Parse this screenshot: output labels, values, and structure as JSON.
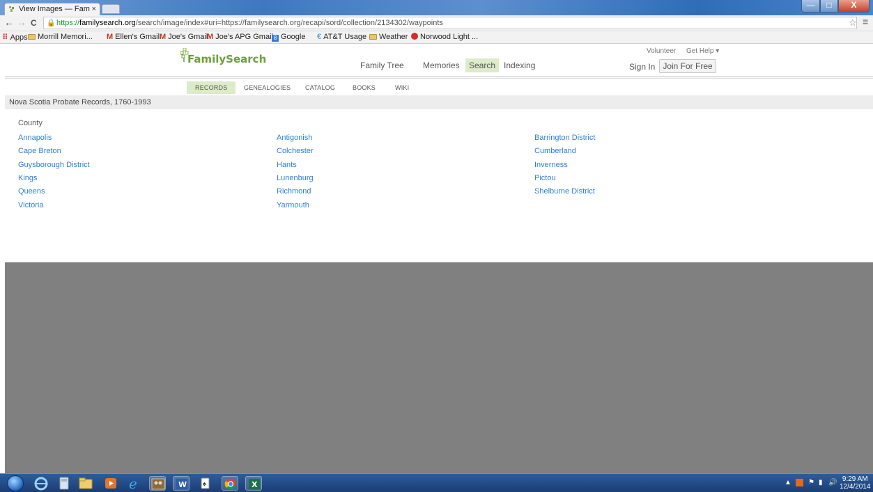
{
  "browser": {
    "tab_title": "View Images — Fam",
    "tab_close": "×",
    "win_min": "—",
    "win_max": "□",
    "win_close": "X",
    "back": "←",
    "forward": "→",
    "reload": "C",
    "url_scheme": "https://",
    "url_host": "familysearch.org",
    "url_path": "/search/image/index#uri=https://familysearch.org/recapi/sord/collection/2134302/waypoints",
    "star": "☆",
    "menu": "≡",
    "bookmarks": [
      {
        "label": "Apps",
        "icon": "apps-icon"
      },
      {
        "label": "Morrill Memori...",
        "icon": "folder-icon"
      },
      {
        "label": "Ellen's Gmail",
        "icon": "gmail-icon"
      },
      {
        "label": "Joe's Gmail",
        "icon": "gmail-icon"
      },
      {
        "label": "Joe's APG Gmail",
        "icon": "gmail-icon"
      },
      {
        "label": "Google",
        "icon": "google-icon"
      },
      {
        "label": "AT&T Usage",
        "icon": "att-icon"
      },
      {
        "label": "Weather",
        "icon": "folder-icon"
      },
      {
        "label": "Norwood Light ...",
        "icon": "norwood-icon"
      }
    ]
  },
  "site": {
    "logo": "FamilySearch",
    "nav": [
      "Family Tree",
      "Memories",
      "Search",
      "Indexing"
    ],
    "nav_selected": "Search",
    "volunteer": "Volunteer",
    "get_help": "Get Help ▾",
    "sign_in": "Sign In",
    "join": "Join For Free",
    "subnav": [
      "RECORDS",
      "GENEALOGIES",
      "CATALOG",
      "BOOKS",
      "WIKI"
    ],
    "subnav_selected": "RECORDS",
    "accent_color": "#dcebc8",
    "link_color": "#2f7fd1"
  },
  "collection": {
    "title": "Nova Scotia Probate Records, 1760-1993",
    "heading": "County",
    "counties": [
      [
        "Annapolis",
        "Antigonish",
        "Barrington District"
      ],
      [
        "Cape Breton",
        "Colchester",
        "Cumberland"
      ],
      [
        "Guysborough District",
        "Hants",
        "Inverness"
      ],
      [
        "Kings",
        "Lunenburg",
        "Pictou"
      ],
      [
        "Queens",
        "Richmond",
        "Shelburne District"
      ],
      [
        "Victoria",
        "Yarmouth"
      ]
    ]
  },
  "taskbar": {
    "apps": [
      "ie-old-icon",
      "calculator-icon",
      "explorer-icon",
      "media-player-icon",
      "internet-explorer-icon",
      "photos-icon",
      "word-icon",
      "solitaire-icon",
      "chrome-icon",
      "excel-icon"
    ],
    "time": "9:29 AM",
    "date": "12/4/2014"
  }
}
